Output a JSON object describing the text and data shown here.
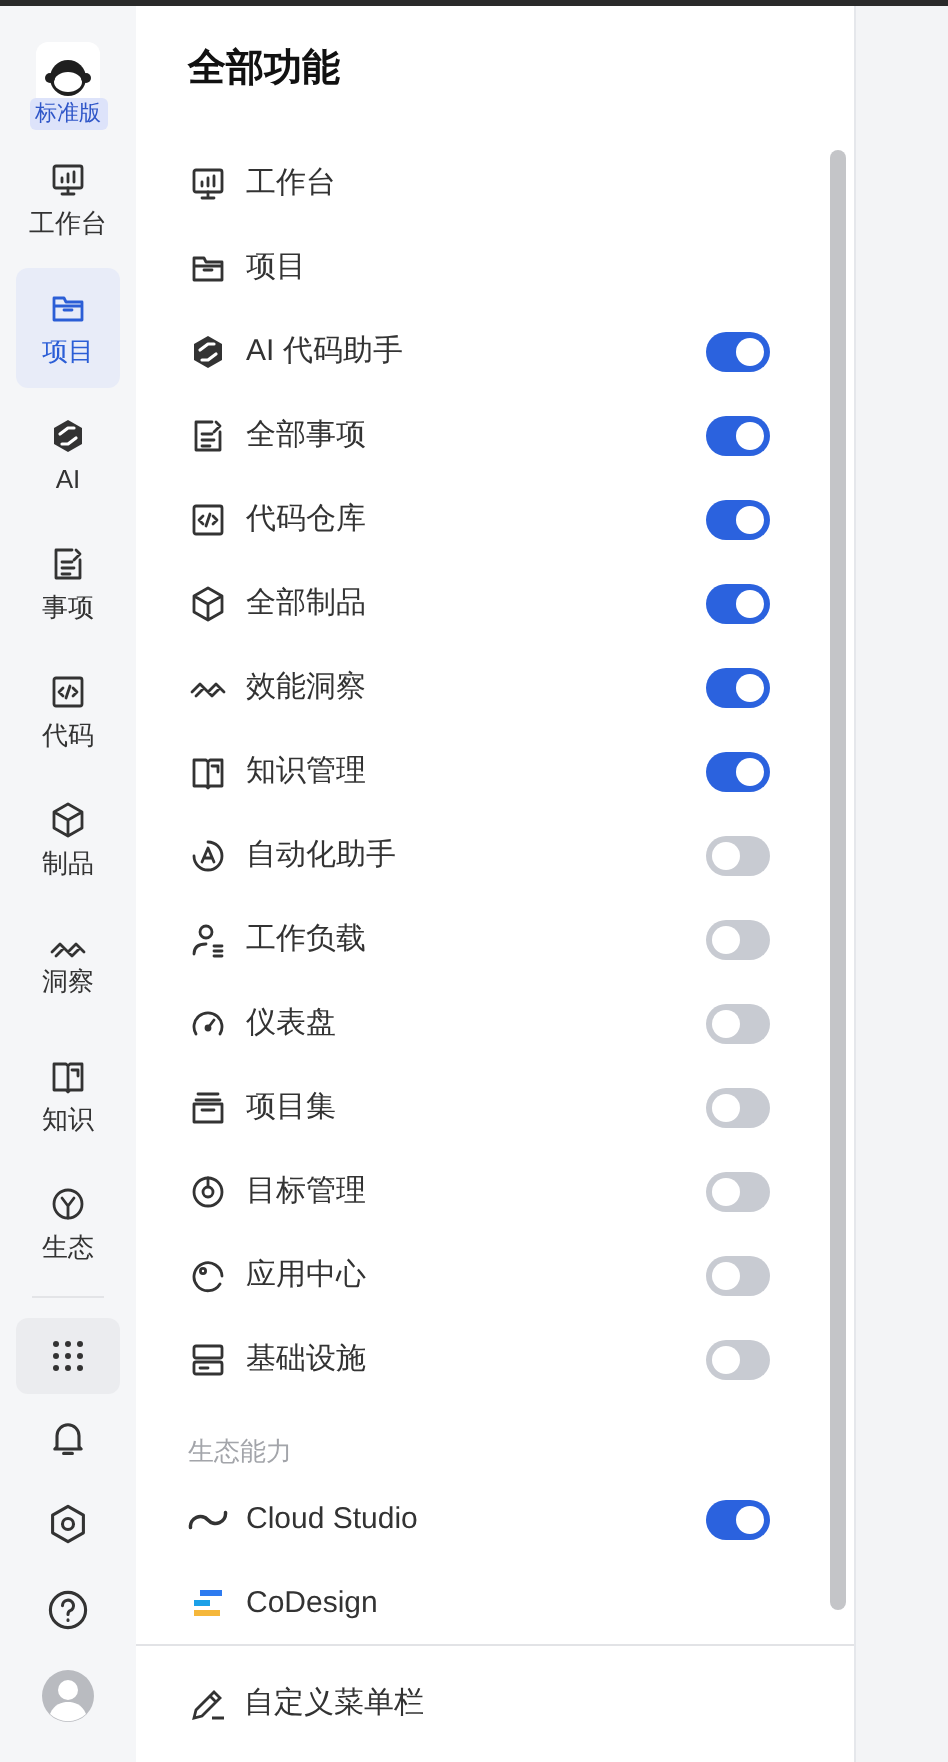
{
  "sidebar": {
    "edition_badge": "标准版",
    "items": [
      {
        "label": "工作台",
        "selected": false
      },
      {
        "label": "项目",
        "selected": true
      },
      {
        "label": "AI",
        "selected": false
      },
      {
        "label": "事项",
        "selected": false
      },
      {
        "label": "代码",
        "selected": false
      },
      {
        "label": "制品",
        "selected": false
      },
      {
        "label": "洞察",
        "selected": false
      },
      {
        "label": "知识",
        "selected": false
      },
      {
        "label": "生态",
        "selected": false
      }
    ]
  },
  "panel": {
    "title": "全部功能",
    "items": [
      {
        "label": "工作台",
        "kind": "plain"
      },
      {
        "label": "项目",
        "kind": "plain"
      },
      {
        "label": "AI 代码助手",
        "kind": "toggle",
        "on": true
      },
      {
        "label": "全部事项",
        "kind": "toggle",
        "on": true
      },
      {
        "label": "代码仓库",
        "kind": "toggle",
        "on": true
      },
      {
        "label": "全部制品",
        "kind": "toggle",
        "on": true
      },
      {
        "label": "效能洞察",
        "kind": "toggle",
        "on": true
      },
      {
        "label": "知识管理",
        "kind": "toggle",
        "on": true
      },
      {
        "label": "自动化助手",
        "kind": "toggle",
        "on": false
      },
      {
        "label": "工作负载",
        "kind": "toggle",
        "on": false
      },
      {
        "label": "仪表盘",
        "kind": "toggle",
        "on": false
      },
      {
        "label": "项目集",
        "kind": "toggle",
        "on": false
      },
      {
        "label": "目标管理",
        "kind": "toggle",
        "on": false
      },
      {
        "label": "应用中心",
        "kind": "toggle",
        "on": false
      },
      {
        "label": "基础设施",
        "kind": "toggle",
        "on": false
      }
    ],
    "section_title": "生态能力",
    "ecosystem_items": [
      {
        "label": "Cloud Studio",
        "kind": "toggle",
        "on": true
      },
      {
        "label": "CoDesign",
        "kind": "plain"
      }
    ],
    "footer_action": "自定义菜单栏"
  }
}
